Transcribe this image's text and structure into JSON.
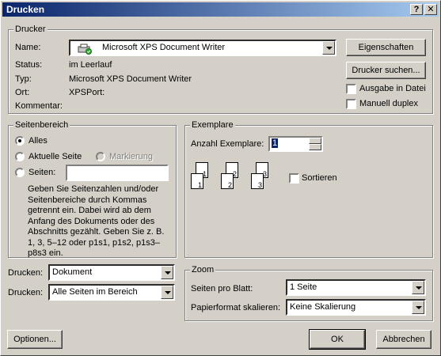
{
  "window": {
    "title": "Drucken",
    "help_label": "?",
    "close_label": "✕"
  },
  "printer": {
    "group_label": "Drucker",
    "name_label": "Name:",
    "name_value": "Microsoft XPS Document Writer",
    "status_label": "Status:",
    "status_value": "im Leerlauf",
    "type_label": "Typ:",
    "type_value": "Microsoft XPS Document Writer",
    "location_label": "Ort:",
    "location_value": "XPSPort:",
    "comment_label": "Kommentar:",
    "properties_button": "Eigenschaften",
    "find_button": "Drucker suchen...",
    "print_to_file_label": "Ausgabe in Datei",
    "manual_duplex_label": "Manuell duplex"
  },
  "page_range": {
    "group_label": "Seitenbereich",
    "all_label": "Alles",
    "current_label": "Aktuelle Seite",
    "selection_label": "Markierung",
    "pages_label": "Seiten:",
    "pages_value": "",
    "help_text": "Geben Sie Seitenzahlen und/oder Seitenbereiche durch Kommas getrennt ein. Dabei wird ab dem Anfang des Dokuments oder des Abschnitts gezählt. Geben Sie z. B. 1, 3, 5–12 oder p1s1, p1s2, p1s3–p8s3 ein."
  },
  "copies": {
    "group_label": "Exemplare",
    "count_label": "Anzahl Exemplare:",
    "count_value": "1",
    "collate_label": "Sortieren",
    "page_numbers": [
      "1",
      "2",
      "3"
    ]
  },
  "print_what": {
    "label": "Drucken:",
    "value": "Dokument"
  },
  "print_range": {
    "label": "Drucken:",
    "value": "Alle Seiten im Bereich"
  },
  "zoom": {
    "group_label": "Zoom",
    "pages_per_sheet_label": "Seiten pro Blatt:",
    "pages_per_sheet_value": "1 Seite",
    "scale_label": "Papierformat skalieren:",
    "scale_value": "Keine Skalierung"
  },
  "footer": {
    "options_button": "Optionen...",
    "ok_button": "OK",
    "cancel_button": "Abbrechen"
  }
}
